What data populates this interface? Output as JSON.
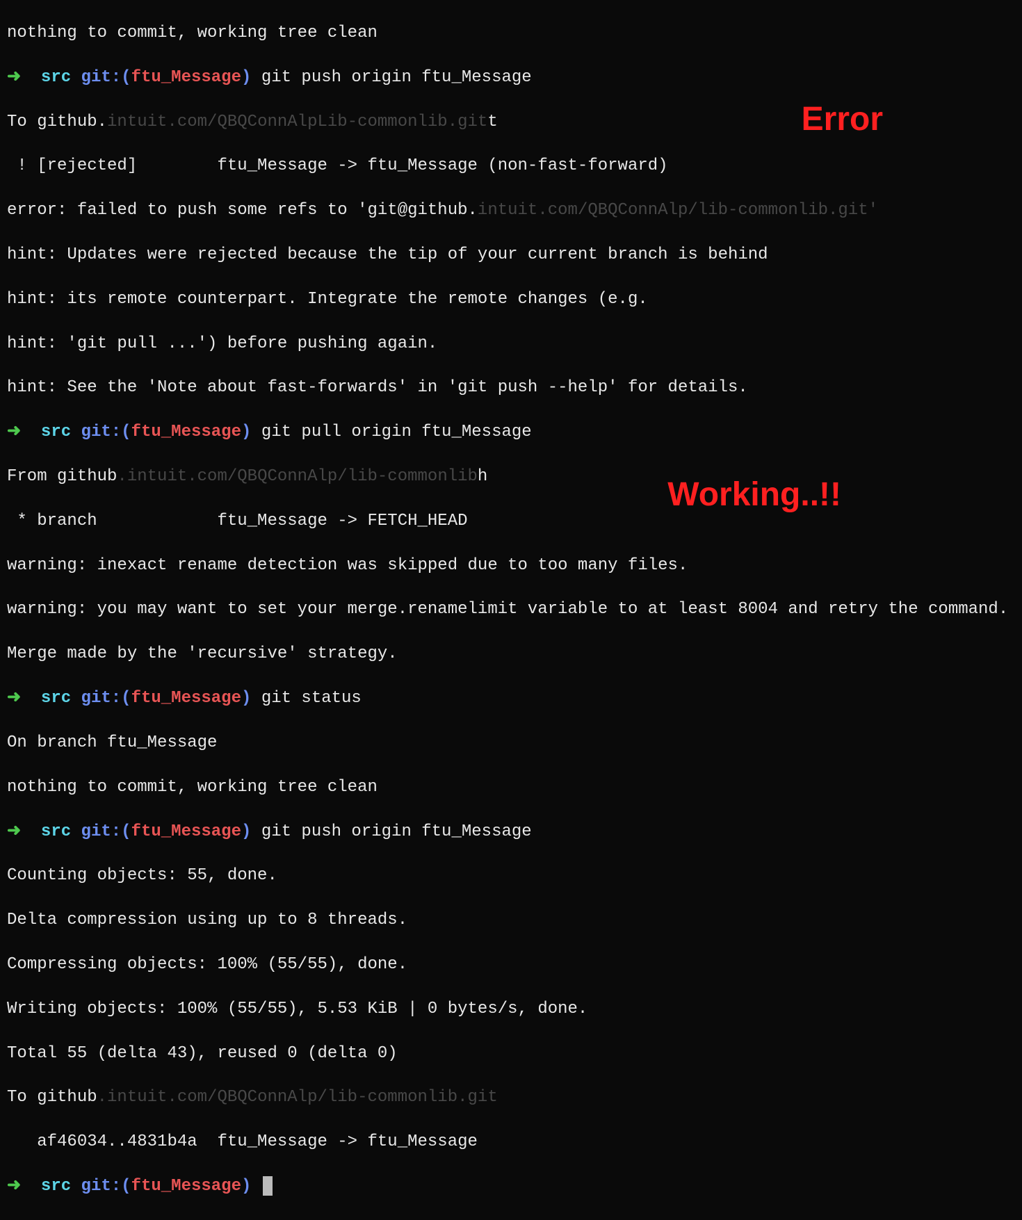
{
  "prompt": {
    "arrow": "➜",
    "dir": "src",
    "git_prefix": "git:(",
    "branch": "ftu_Message",
    "git_suffix": ")"
  },
  "lines": {
    "l0": "nothing to commit, working tree clean",
    "cmd1": "git push origin ftu_Message",
    "l2a": "To github.",
    "l2b": "intuit.com/QBQConnAlpLib-commonlib.git",
    "l2c": "t",
    "l3": " ! [rejected]        ftu_Message -> ftu_Message (non-fast-forward)",
    "l4a": "error: failed to push some refs to 'git@github.",
    "l4b": "intuit.com/QBQConnAlp/lib-commonlib.git'",
    "l5": "hint: Updates were rejected because the tip of your current branch is behind",
    "l6": "hint: its remote counterpart. Integrate the remote changes (e.g.",
    "l7": "hint: 'git pull ...') before pushing again.",
    "l8": "hint: See the 'Note about fast-forwards' in 'git push --help' for details.",
    "cmd2": "git pull origin ftu_Message",
    "l10a": "From github",
    "l10b": ".intuit.com/QBQConnAlp/lib-commonlib",
    "l10c": "h",
    "l11": " * branch            ftu_Message -> FETCH_HEAD",
    "l12": "warning: inexact rename detection was skipped due to too many files.",
    "l13": "warning: you may want to set your merge.renamelimit variable to at least 8004 and retry the command.",
    "l14": "Merge made by the 'recursive' strategy.",
    "cmd3": "git status",
    "l16": "On branch ftu_Message",
    "l17": "nothing to commit, working tree clean",
    "cmd4": "git push origin ftu_Message",
    "l19": "Counting objects: 55, done.",
    "l20": "Delta compression using up to 8 threads.",
    "l21": "Compressing objects: 100% (55/55), done.",
    "l22": "Writing objects: 100% (55/55), 5.53 KiB | 0 bytes/s, done.",
    "l23": "Total 55 (delta 43), reused 0 (delta 0)",
    "l24a": "To github",
    "l24b": ".intuit.com/QBQConnAlp/lib-commonlib.git",
    "l25": "   af46034..4831b4a  ftu_Message -> ftu_Message"
  },
  "annotations": {
    "error": "Error",
    "working": "Working..!!"
  }
}
